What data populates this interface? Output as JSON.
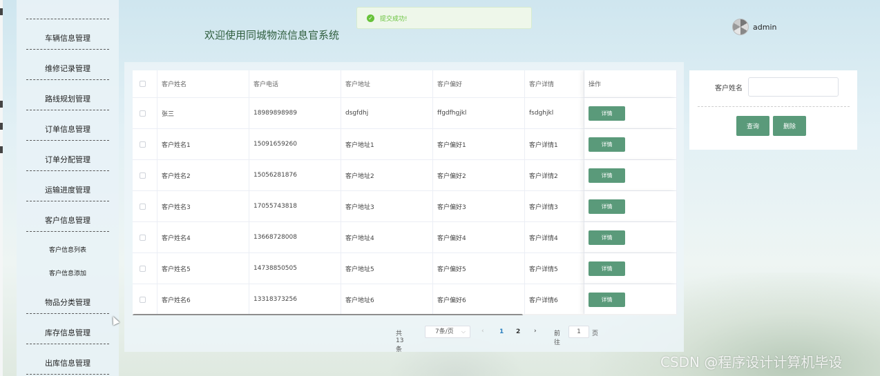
{
  "app": {
    "title": "欢迎使用同城物流信息官系统",
    "user_name": "admin"
  },
  "toast": {
    "text": "提交成功!",
    "icon": "check-circle-icon"
  },
  "sidebar": {
    "items": [
      {
        "label": "车辆信息管理"
      },
      {
        "label": "维修记录管理"
      },
      {
        "label": "路线规划管理"
      },
      {
        "label": "订单信息管理"
      },
      {
        "label": "订单分配管理"
      },
      {
        "label": "运输进度管理"
      },
      {
        "label": "客户信息管理"
      },
      {
        "label": "物品分类管理"
      },
      {
        "label": "库存信息管理"
      },
      {
        "label": "出库信息管理"
      }
    ],
    "sub_items": [
      {
        "label": "客户信息列表"
      },
      {
        "label": "客户信息添加"
      }
    ]
  },
  "table": {
    "headers": [
      "客户姓名",
      "客户电话",
      "客户地址",
      "客户偏好",
      "客户详情",
      "操作"
    ],
    "action_label": "详情",
    "rows": [
      [
        "张三",
        "18989898989",
        "dsgfdhj",
        "ffgdfhgjkl",
        "fsdghjkl"
      ],
      [
        "客户姓名1",
        "15091659260",
        "客户地址1",
        "客户偏好1",
        "客户详情1"
      ],
      [
        "客户姓名2",
        "15056281876",
        "客户地址2",
        "客户偏好2",
        "客户详情2"
      ],
      [
        "客户姓名3",
        "17055743818",
        "客户地址3",
        "客户偏好3",
        "客户详情3"
      ],
      [
        "客户姓名4",
        "13668728008",
        "客户地址4",
        "客户偏好4",
        "客户详情4"
      ],
      [
        "客户姓名5",
        "14738850505",
        "客户地址5",
        "客户偏好5",
        "客户详情5"
      ],
      [
        "客户姓名6",
        "13318373256",
        "客户地址6",
        "客户偏好6",
        "客户详情6"
      ]
    ]
  },
  "pagination": {
    "total": "共 13 条",
    "page_size": "7条/页",
    "pages": [
      "1",
      "2"
    ],
    "current_page": "1",
    "goto_label": "前往",
    "goto_value": "1",
    "goto_unit": "页"
  },
  "search": {
    "label": "客户姓名",
    "value": "",
    "query_button": "查询",
    "delete_button": "删除"
  },
  "watermark": "CSDN @程序设计计算机毕设",
  "colors": {
    "accent": "#5a9a7a",
    "title": "#2f5e3e",
    "success": "#67c23a"
  }
}
